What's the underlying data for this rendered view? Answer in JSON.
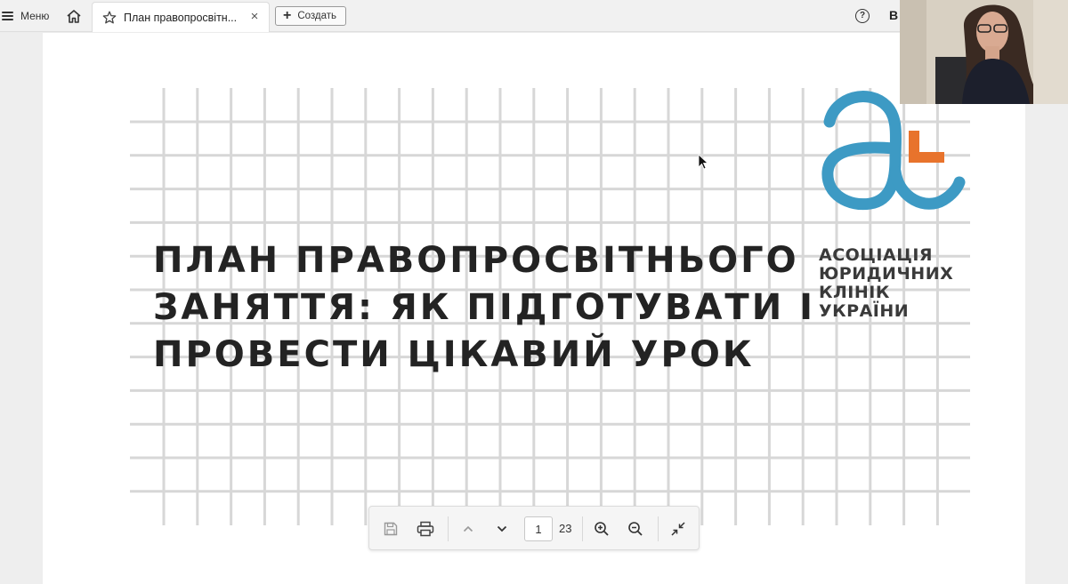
{
  "topbar": {
    "menu_label": "Меню",
    "tab_title": "План правопросвітн...",
    "tab_close": "×",
    "create_label": "Создать",
    "help_label": "?",
    "user_initial": "В"
  },
  "slide": {
    "title_lines": [
      "ПЛАН ПРАВОПРОСВІТНЬОГО",
      "ЗАНЯТТЯ: ЯК ПІДГОТУВАТИ І",
      "ПРОВЕСТИ ЦІКАВИЙ УРОК"
    ],
    "logo_text_lines": [
      "АСОЦІАЦІЯ",
      "ЮРИДИЧНИХ",
      "КЛІНІК",
      "УКРАЇНИ"
    ],
    "logo_colors": {
      "blue": "#3d9ac4",
      "orange": "#e8732c"
    }
  },
  "pdf_toolbar": {
    "current_page": "1",
    "total_pages": "23"
  },
  "icons": {
    "menu": "menu-icon",
    "home": "home-icon",
    "star": "star-icon",
    "save": "save-icon",
    "print": "print-icon",
    "prev": "chevron-up-icon",
    "next": "chevron-down-icon",
    "zoom_in": "zoom-in-icon",
    "zoom_out": "zoom-out-icon",
    "exit_fullscreen": "collapse-icon"
  }
}
